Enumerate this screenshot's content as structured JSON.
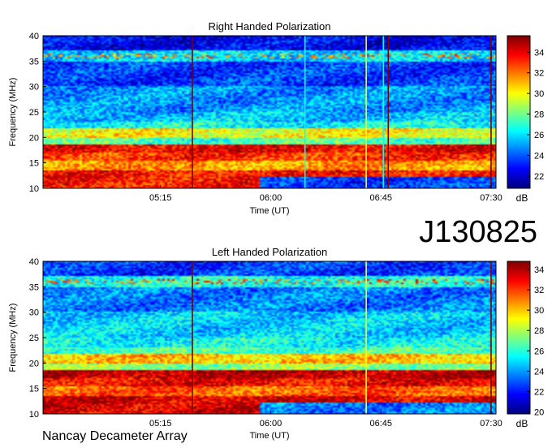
{
  "observation_id": "J130825",
  "instrument": "Nancay Decameter Array",
  "colors": {
    "colormap": [
      "#00007f",
      "#0000ff",
      "#007fff",
      "#00ffff",
      "#7fff7f",
      "#ffff00",
      "#ff7f00",
      "#ff0000",
      "#7f0000"
    ]
  },
  "chart_data": [
    {
      "type": "heatmap",
      "title": "Right Handed Polarization",
      "xlabel": "Time (UT)",
      "ylabel": "Frequency (MHz)",
      "x_ticks": [
        "05:15",
        "06:00",
        "06:45",
        "07:30"
      ],
      "x_tick_minutes": [
        315,
        360,
        405,
        450
      ],
      "xlim_minutes": [
        267,
        452
      ],
      "y_ticks": [
        "10",
        "15",
        "20",
        "25",
        "30",
        "35",
        "40"
      ],
      "y_tick_values": [
        10,
        15,
        20,
        25,
        30,
        35,
        40
      ],
      "ylim": [
        10,
        40
      ],
      "colorbar_label": "dB",
      "colorbar_ticks": [
        "22",
        "24",
        "26",
        "28",
        "30",
        "32",
        "34"
      ],
      "colorbar_tick_values": [
        22,
        24,
        26,
        28,
        30,
        32,
        34
      ],
      "colorbar_range": [
        20.8,
        35.6
      ],
      "vertical_lines": [
        {
          "t_min": 328,
          "color": "#7f0000"
        },
        {
          "t_min": 374,
          "color": "#00ffff"
        },
        {
          "t_min": 399,
          "color": "#ffff00"
        },
        {
          "t_min": 406,
          "color": "#00ffff"
        },
        {
          "t_min": 408,
          "color": "#7f0000"
        },
        {
          "t_min": 450,
          "color": "#7f0000"
        }
      ],
      "step_change_minute": 356
    },
    {
      "type": "heatmap",
      "title": "Left Handed Polarization",
      "xlabel": "Time (UT)",
      "ylabel": "Frequency (MHz)",
      "x_ticks": [
        "05:15",
        "06:00",
        "06:45",
        "07:30"
      ],
      "x_tick_minutes": [
        315,
        360,
        405,
        450
      ],
      "xlim_minutes": [
        267,
        452
      ],
      "y_ticks": [
        "10",
        "15",
        "20",
        "25",
        "30",
        "35",
        "40"
      ],
      "y_tick_values": [
        10,
        15,
        20,
        25,
        30,
        35,
        40
      ],
      "ylim": [
        10,
        40
      ],
      "colorbar_label": "dB",
      "colorbar_ticks": [
        "20",
        "22",
        "24",
        "26",
        "28",
        "30",
        "32",
        "34"
      ],
      "colorbar_tick_values": [
        20,
        22,
        24,
        26,
        28,
        30,
        32,
        34
      ],
      "colorbar_range": [
        19.8,
        34.8
      ],
      "vertical_lines": [
        {
          "t_min": 328,
          "color": "#7f0000"
        },
        {
          "t_min": 399,
          "color": "#ffff00"
        },
        {
          "t_min": 450,
          "color": "#7f0000"
        }
      ],
      "step_change_minute": 356
    }
  ]
}
